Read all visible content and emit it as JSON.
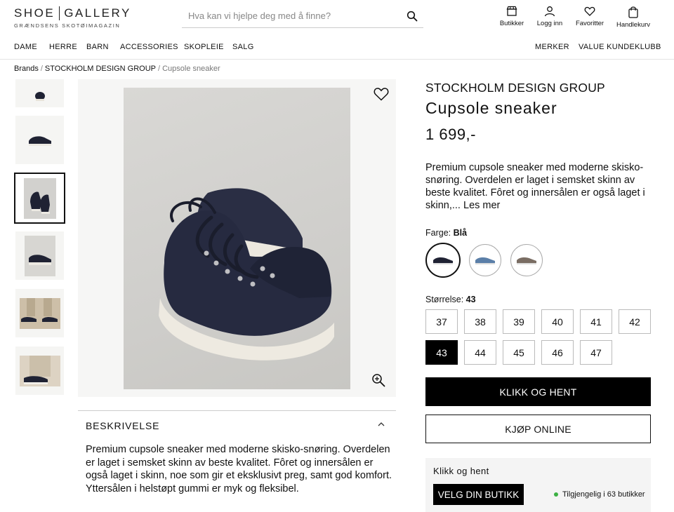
{
  "logo": {
    "main_left": "SHOE",
    "main_right": "GALLERY",
    "tagline": "GRÆNDSENS SKOTØIMAGAZIN"
  },
  "search": {
    "placeholder": "Hva kan vi hjelpe deg med å finne?"
  },
  "header_icons": [
    {
      "label": "Butikker",
      "icon": "store-icon"
    },
    {
      "label": "Logg inn",
      "icon": "user-icon"
    },
    {
      "label": "Favoritter",
      "icon": "heart-icon"
    },
    {
      "label": "Handlekurv",
      "icon": "bag-icon"
    }
  ],
  "nav": {
    "left": [
      "DAME",
      "HERRE",
      "BARN",
      "ACCESSORIES",
      "SKOPLEIE",
      "SALG"
    ],
    "right": [
      "MERKER",
      "VALUE KUNDEKLUBB"
    ]
  },
  "breadcrumb": {
    "items": [
      "Brands",
      "STOCKHOLM DESIGN GROUP",
      "Cupsole sneaker"
    ],
    "separator": "/"
  },
  "product": {
    "brand": "STOCKHOLM DESIGN GROUP",
    "name": "Cupsole sneaker",
    "price": "1 699,-",
    "short_desc": "Premium cupsole sneaker med moderne skisko-snøring. Overdelen er laget i semsket skinn av beste kvalitet. Fôret og innersålen er også laget i skinn,...",
    "read_more": "Les mer",
    "color_label": "Farge:",
    "color_value": "Blå",
    "colors": [
      {
        "name": "navy",
        "hex": "#1f2233"
      },
      {
        "name": "blue",
        "hex": "#5b7fa8"
      },
      {
        "name": "taupe",
        "hex": "#7a6d63"
      }
    ],
    "size_label": "Størrelse:",
    "size_value": "43",
    "sizes": [
      "37",
      "38",
      "39",
      "40",
      "41",
      "42",
      "43",
      "44",
      "45",
      "46",
      "47"
    ],
    "selected_size": "43"
  },
  "buttons": {
    "click_collect": "KLIKK OG HENT",
    "buy_online": "KJØP ONLINE"
  },
  "store": {
    "title": "Klikk og hent",
    "button": "VELG DIN BUTIKK",
    "availability": "Tilgjengelig i 63 butikker",
    "status_color": "#3cb043"
  },
  "description": {
    "title": "BESKRIVELSE",
    "text": "Premium cupsole sneaker med moderne skisko-snøring. Overdelen er laget i semsket skinn av beste kvalitet. Fôret og innersålen er også laget i skinn, noe som gir et eksklusivt preg, samt god komfort. Yttersålen i helstøpt gummi er myk og fleksibel."
  }
}
